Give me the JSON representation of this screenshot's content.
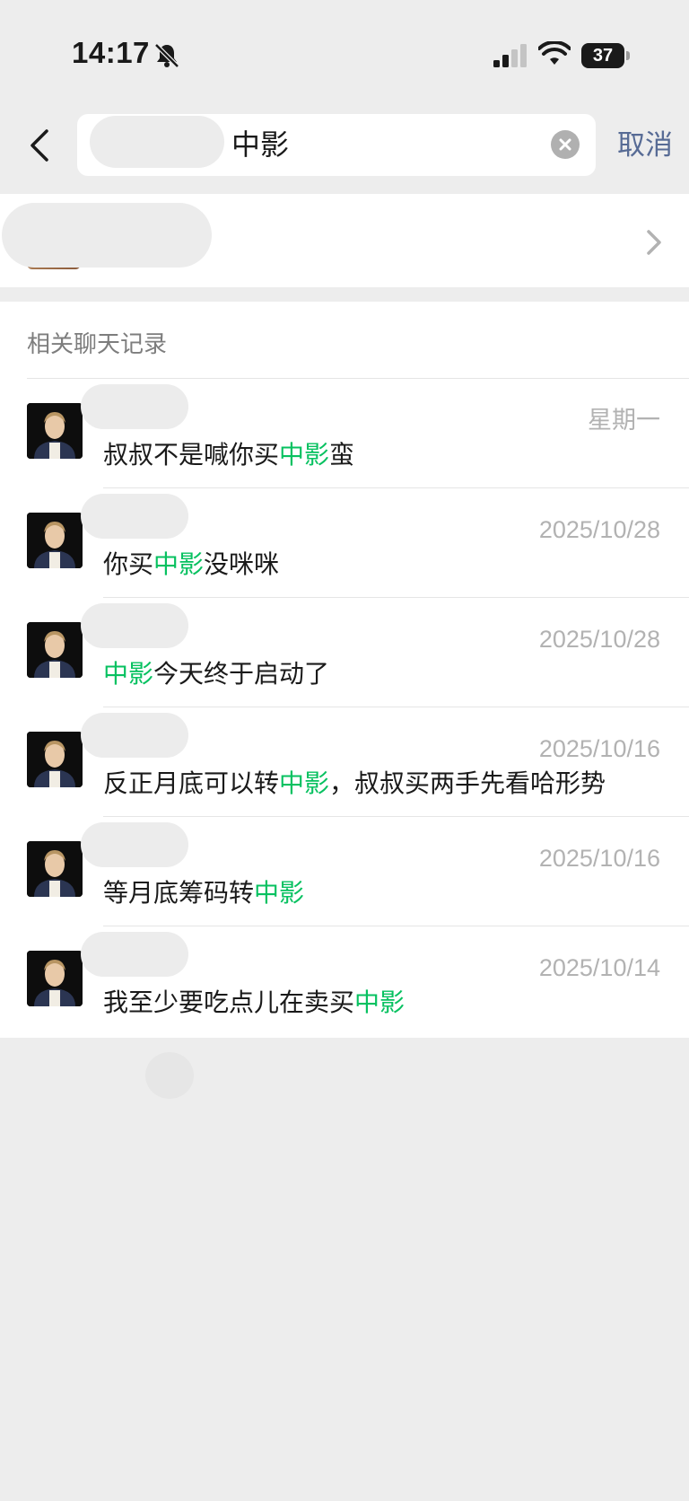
{
  "status_bar": {
    "time": "14:17",
    "battery": "37",
    "icons": [
      "bell-muted-icon",
      "signal-icon",
      "wifi-icon",
      "battery-icon"
    ]
  },
  "search": {
    "query": "中影",
    "cancel_label": "取消"
  },
  "records": {
    "section_title": "相关聊天记录",
    "highlight_color": "#07c160",
    "items": [
      {
        "date": "星期一",
        "pre": "叔叔不是喊你买",
        "hl": "中影",
        "post": "蛮"
      },
      {
        "date": "2025/10/28",
        "pre": "你买",
        "hl": "中影",
        "post": "没咪咪"
      },
      {
        "date": "2025/10/28",
        "pre": "",
        "hl": "中影",
        "post": "今天终于启动了"
      },
      {
        "date": "2025/10/16",
        "pre": "反正月底可以转",
        "hl": "中影",
        "post": "，叔叔买两手先看哈形势"
      },
      {
        "date": "2025/10/16",
        "pre": "等月底筹码转",
        "hl": "中影",
        "post": ""
      },
      {
        "date": "2025/10/14",
        "pre": "我至少要吃点儿在卖买",
        "hl": "中影",
        "post": ""
      }
    ]
  },
  "colors": {
    "link": "#576b95",
    "background": "#ededed",
    "date_gray": "#b2b2b2"
  }
}
